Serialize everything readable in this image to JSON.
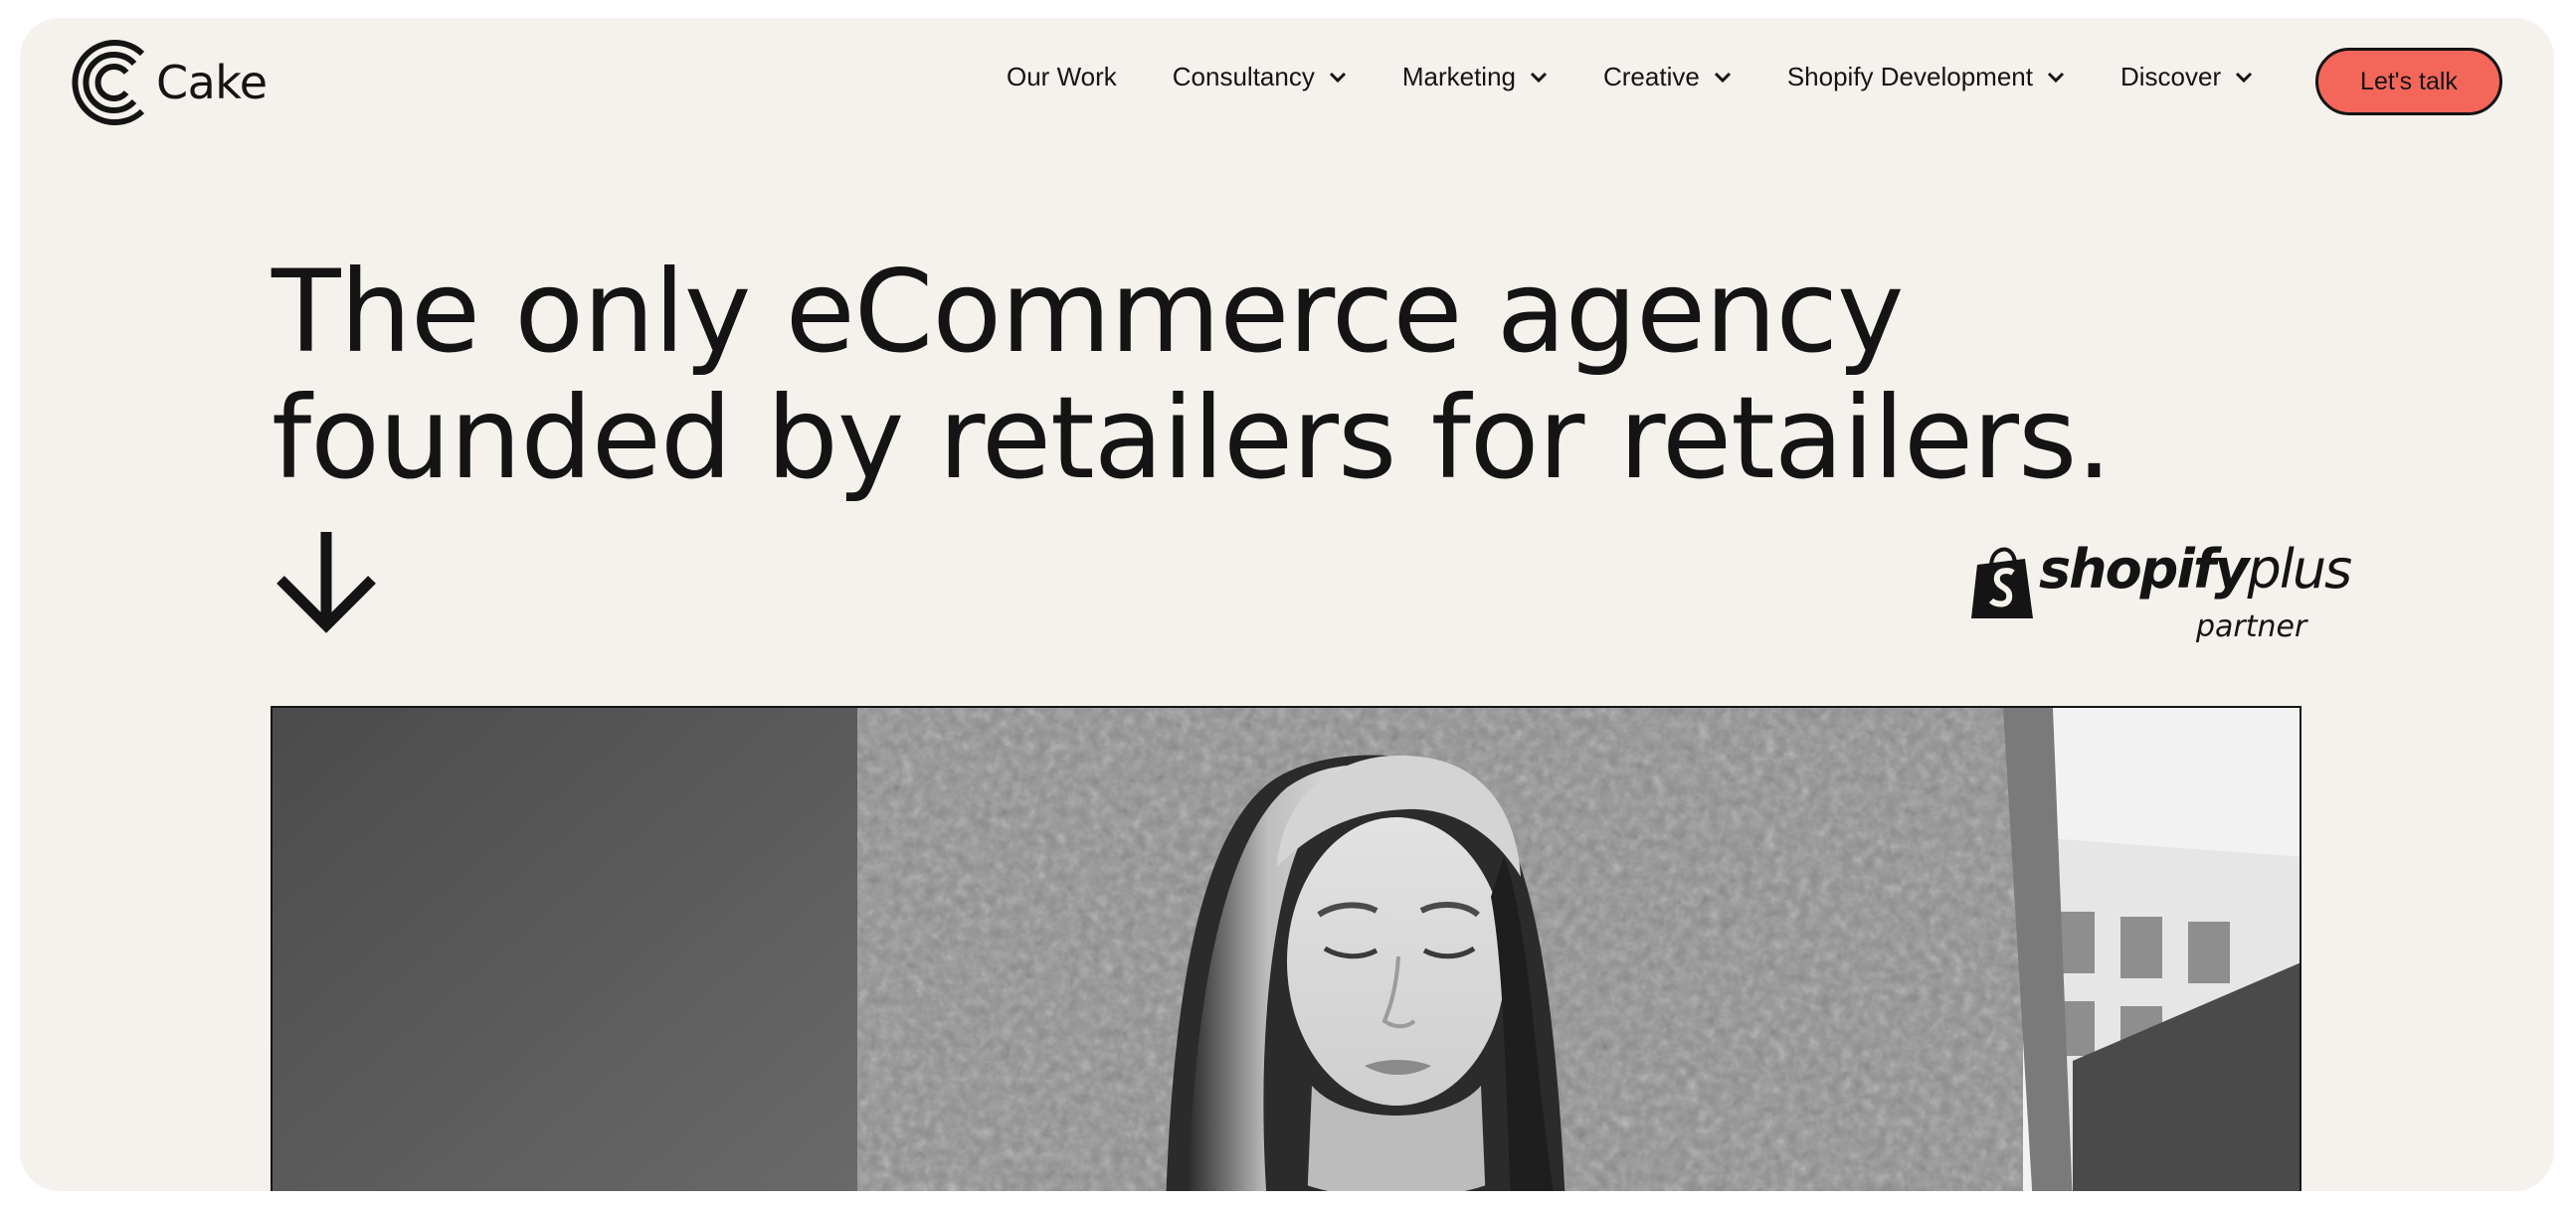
{
  "brand": {
    "name": "Cake",
    "logo_icon": "concentric-c-logo"
  },
  "nav": {
    "items": [
      {
        "label": "Our Work",
        "has_dropdown": false
      },
      {
        "label": "Consultancy",
        "has_dropdown": true
      },
      {
        "label": "Marketing",
        "has_dropdown": true
      },
      {
        "label": "Creative",
        "has_dropdown": true
      },
      {
        "label": "Shopify Development",
        "has_dropdown": true
      },
      {
        "label": "Discover",
        "has_dropdown": true
      }
    ],
    "chevron_icon": "chevron-down-icon",
    "cta_label": "Let's talk"
  },
  "hero": {
    "line1": "The only eCommerce agency",
    "line2": "founded by retailers for retailers.",
    "arrow_icon": "arrow-down-icon"
  },
  "badge": {
    "bag_icon": "shopify-bag-icon",
    "word_bold": "shopify",
    "word_light": "plus",
    "subtitle": "partner"
  },
  "colors": {
    "background": "#f5f1ec",
    "text": "#141414",
    "cta": "#f4665a"
  }
}
